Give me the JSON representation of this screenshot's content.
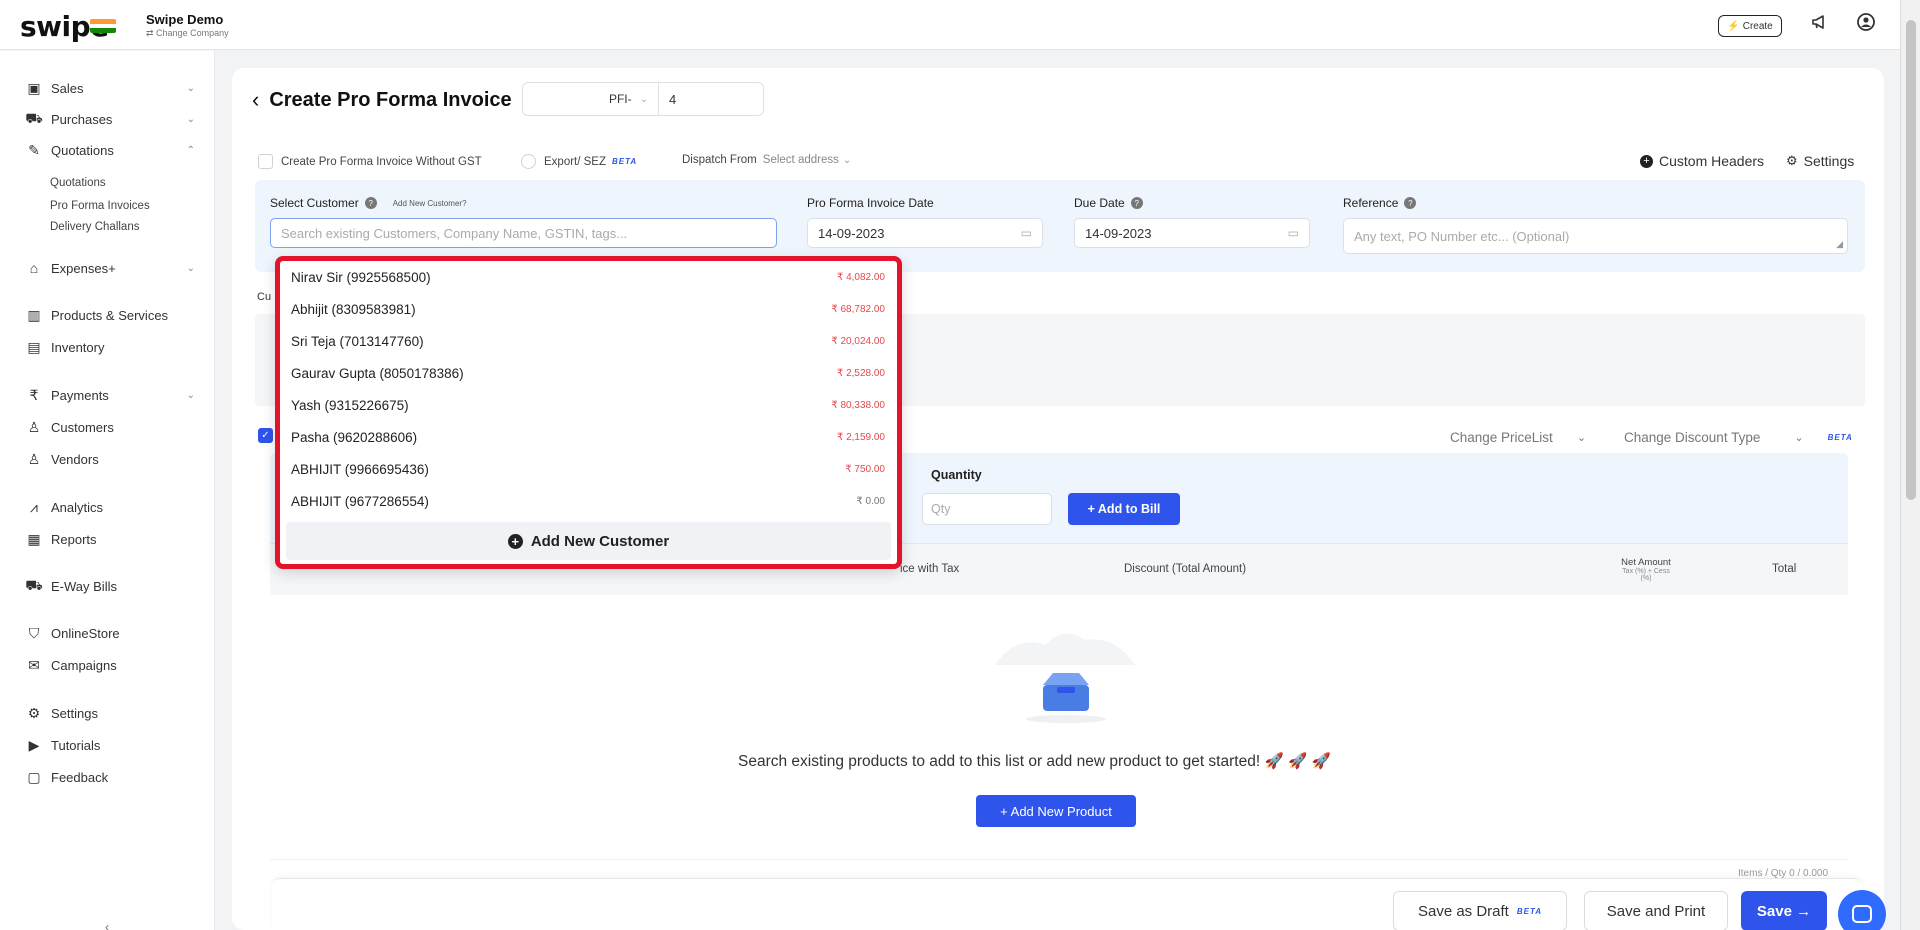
{
  "topbar": {
    "logo": "swipe",
    "company_name": "Swipe Demo",
    "change_company": "⇄ Change Company",
    "create_label": "Create",
    "flag_colors": [
      "#ff9933",
      "#ffffff",
      "#138808"
    ]
  },
  "sidebar": {
    "items": [
      {
        "label": "Sales",
        "icon": "sales-icon",
        "glyph": "▣"
      },
      {
        "label": "Purchases",
        "icon": "cart-icon",
        "glyph": "⛟"
      },
      {
        "label": "Quotations",
        "icon": "pen-icon",
        "glyph": "✎"
      },
      {
        "label": "Expenses+",
        "icon": "tag-icon",
        "glyph": "⌂"
      },
      {
        "label": "Products & Services",
        "icon": "barcode-icon",
        "glyph": "▥"
      },
      {
        "label": "Inventory",
        "icon": "inventory-icon",
        "glyph": "▤"
      },
      {
        "label": "Payments",
        "icon": "rupee-icon",
        "glyph": "₹"
      },
      {
        "label": "Customers",
        "icon": "user-icon",
        "glyph": "♙"
      },
      {
        "label": "Vendors",
        "icon": "users-icon",
        "glyph": "♙"
      },
      {
        "label": "Analytics",
        "icon": "chart-icon",
        "glyph": "⩘"
      },
      {
        "label": "Reports",
        "icon": "report-icon",
        "glyph": "▦"
      },
      {
        "label": "E-Way Bills",
        "icon": "truck-icon",
        "glyph": "⛟"
      },
      {
        "label": "OnlineStore",
        "icon": "store-icon",
        "glyph": "⛉"
      },
      {
        "label": "Campaigns",
        "icon": "megaphone-icon",
        "glyph": "✉"
      },
      {
        "label": "Settings",
        "icon": "gear-icon",
        "glyph": "⚙"
      },
      {
        "label": "Tutorials",
        "icon": "play-icon",
        "glyph": "▶"
      },
      {
        "label": "Feedback",
        "icon": "feedback-icon",
        "glyph": "▢"
      }
    ],
    "quotation_sub": [
      "Quotations",
      "Pro Forma Invoices",
      "Delivery Challans"
    ],
    "collapse": "‹"
  },
  "header": {
    "title": "Create Pro Forma Invoice",
    "prefix": "PFI-",
    "number": "4"
  },
  "options": {
    "without_gst": "Create Pro Forma Invoice Without GST",
    "export_sez": "Export/ SEZ",
    "beta": "BETA",
    "dispatch_from": "Dispatch From",
    "select_address": "Select address",
    "custom_headers": "Custom Headers",
    "settings": "Settings"
  },
  "customer_panel": {
    "select_customer": "Select Customer",
    "add_new_customer_q": "Add New Customer?",
    "search_placeholder": "Search existing Customers, Company Name, GSTIN, tags...",
    "invoice_date_label": "Pro Forma Invoice Date",
    "invoice_date": "14-09-2023",
    "due_date_label": "Due Date",
    "due_date": "14-09-2023",
    "reference_label": "Reference",
    "reference_placeholder": "Any text, PO Number etc... (Optional)"
  },
  "dropdown": {
    "customers": [
      {
        "name": "Nirav Sir (9925568500)",
        "amount": "₹ 4,082.00"
      },
      {
        "name": "Abhijit (8309583981)",
        "amount": "₹ 68,782.00"
      },
      {
        "name": "Sri Teja (7013147760)",
        "amount": "₹ 20,024.00"
      },
      {
        "name": "Gaurav Gupta (8050178386)",
        "amount": "₹ 2,528.00"
      },
      {
        "name": "Yash (9315226675)",
        "amount": "₹ 80,338.00"
      },
      {
        "name": "Pasha (9620288606)",
        "amount": "₹ 2,159.00"
      },
      {
        "name": "ABHIJIT (9966695436)",
        "amount": "₹ 750.00"
      },
      {
        "name": "ABHIJIT (9677286554)",
        "amount": "₹ 0.00"
      }
    ],
    "add_new": "Add New Customer"
  },
  "background": {
    "cu_label": "Cu",
    "change_pricelist": "Change PriceList",
    "change_discount": "Change Discount Type",
    "beta": "BETA",
    "quantity_label": "Quantity",
    "qty_placeholder": "Qty",
    "add_to_bill": "+ Add to Bill"
  },
  "table": {
    "col_price": "ice with Tax",
    "col_discount": "Discount (Total Amount)",
    "col_net": "Net Amount",
    "col_net_sub": "Tax (%) + Cess (%)",
    "col_total": "Total"
  },
  "empty": {
    "text": "Search existing products to add to this list or add new product to get started!",
    "rockets": "🚀 🚀 🚀",
    "add_product": "+ Add New Product"
  },
  "footer": {
    "items_qty": "Items / Qty 0 / 0.000",
    "save_draft": "Save as Draft",
    "beta": "BETA",
    "save_print": "Save and Print",
    "save": "Save →"
  }
}
